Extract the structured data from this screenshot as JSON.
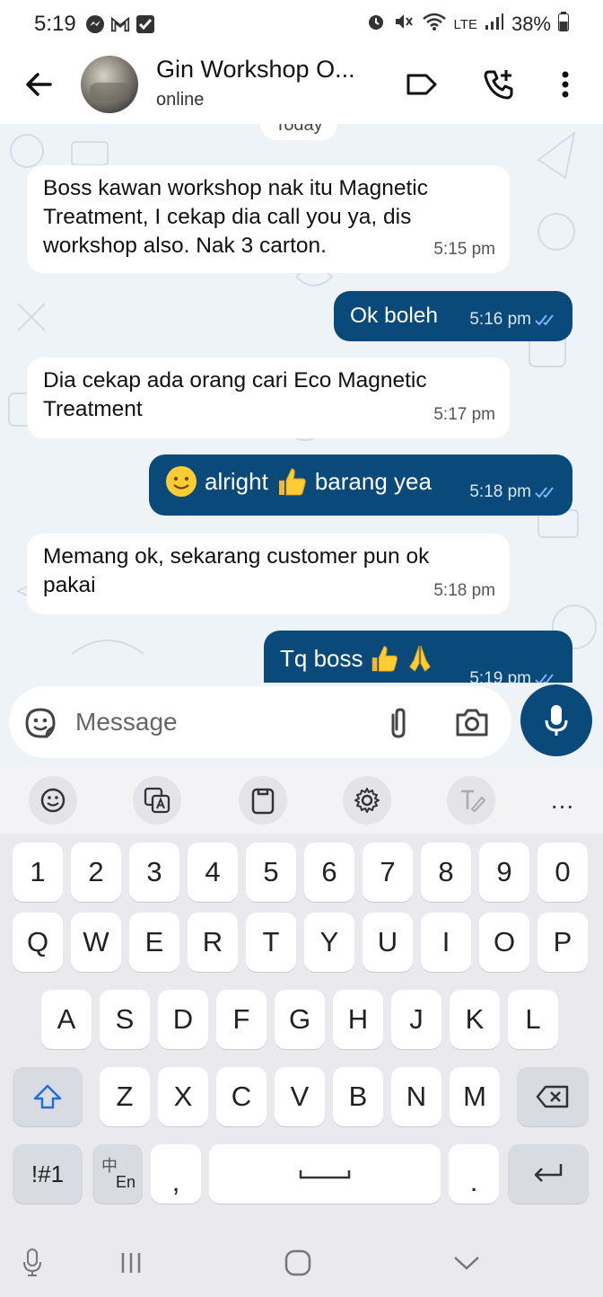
{
  "status_bar": {
    "time": "5:19",
    "battery": "38%",
    "volte_label": "LTE"
  },
  "header": {
    "contact_name": "Gin Workshop O...",
    "contact_status": "online"
  },
  "chat": {
    "date_chip": "Today",
    "messages": [
      {
        "direction": "in",
        "text": "Boss kawan workshop nak itu Magnetic\nTreatment, I cekap dia call you ya, dis\nworkshop also. Nak 3 carton.",
        "time": "5:15 pm"
      },
      {
        "direction": "out",
        "text": "Ok boleh",
        "time": "5:16 pm",
        "read": true
      },
      {
        "direction": "in",
        "text": "Dia cekap ada orang cari Eco Magnetic\nTreatment",
        "time": "5:17 pm"
      },
      {
        "direction": "out",
        "text_parts": [
          "alright",
          "barang yea"
        ],
        "emojis": [
          "smiling-face",
          "thumbs-up"
        ],
        "time": "5:18 pm",
        "read": true
      },
      {
        "direction": "in",
        "text": "Memang ok, sekarang customer pun ok\npakai",
        "time": "5:18 pm"
      },
      {
        "direction": "out",
        "text": "Tq boss",
        "emojis": [
          "thumbs-up",
          "folded-hands"
        ],
        "time": "5:19 pm",
        "read": true
      }
    ]
  },
  "input": {
    "placeholder": "Message"
  },
  "keyboard": {
    "toolbar": [
      "emoji-icon",
      "translate-icon",
      "clipboard-icon",
      "settings-icon",
      "handwriting-icon",
      "more-icon"
    ],
    "more_label": "...",
    "rows": {
      "numbers": [
        "1",
        "2",
        "3",
        "4",
        "5",
        "6",
        "7",
        "8",
        "9",
        "0"
      ],
      "row1": [
        "Q",
        "W",
        "E",
        "R",
        "T",
        "Y",
        "U",
        "I",
        "O",
        "P"
      ],
      "row2": [
        "A",
        "S",
        "D",
        "F",
        "G",
        "H",
        "J",
        "K",
        "L"
      ],
      "row3": [
        "Z",
        "X",
        "C",
        "V",
        "B",
        "N",
        "M"
      ]
    },
    "symbols_key": "!#1",
    "lang_key_top": "中",
    "lang_key_bottom": "En",
    "comma": ",",
    "period": "."
  },
  "colors": {
    "accent": "#0a4a7a",
    "chat_bg": "#eef3f7",
    "incoming_bubble": "#ffffff",
    "read_ticks": "#7fb2ff"
  }
}
